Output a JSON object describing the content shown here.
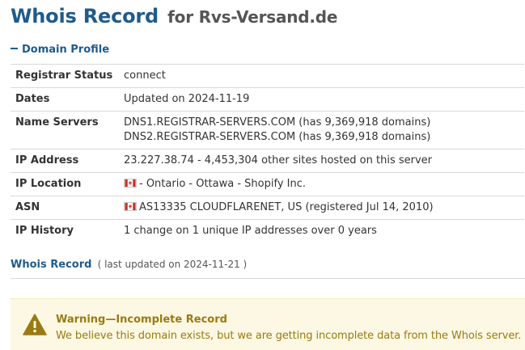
{
  "header": {
    "title": "Whois Record",
    "subtitle": "for Rvs-Versand.de"
  },
  "section": {
    "title": "Domain Profile",
    "icon": "collapse-icon"
  },
  "profile": [
    {
      "label": "Registrar Status",
      "lines": [
        "connect"
      ]
    },
    {
      "label": "Dates",
      "lines": [
        "Updated on 2024-11-19"
      ]
    },
    {
      "label": "Name Servers",
      "lines": [
        "DNS1.REGISTRAR-SERVERS.COM (has 9,369,918 domains)",
        "DNS2.REGISTRAR-SERVERS.COM (has 9,369,918 domains)"
      ]
    },
    {
      "label": "IP Address",
      "lines": [
        "23.227.38.74 - 4,453,304 other sites hosted on this server"
      ]
    },
    {
      "label": "IP Location",
      "lines": [
        "- Ontario - Ottawa - Shopify Inc."
      ],
      "flag": "canada-flag-icon"
    },
    {
      "label": "ASN",
      "lines": [
        "AS13335 CLOUDFLARENET, US (registered Jul 14, 2010)"
      ],
      "flag": "canada-flag-icon"
    },
    {
      "label": "IP History",
      "lines": [
        "1 change on 1 unique IP addresses over 0 years"
      ]
    }
  ],
  "whois": {
    "link": "Whois Record",
    "updated": "( last updated on 2024-11-21 )"
  },
  "warning": {
    "title": "Warning—Incomplete Record",
    "text": "We believe this domain exists, but we are getting incomplete data from the Whois server.",
    "icon": "warning-icon",
    "color": "#9a7a12",
    "background": "#fcf8e3"
  },
  "colors": {
    "accent": "#1f5b8c"
  }
}
